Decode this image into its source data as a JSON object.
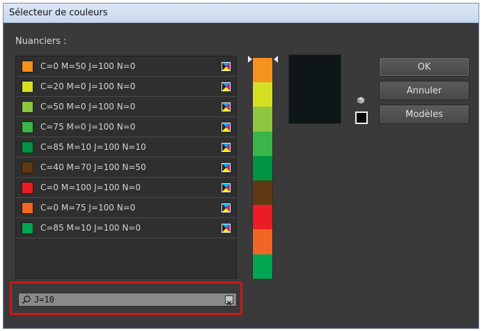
{
  "window": {
    "title": "Sélecteur de couleurs"
  },
  "nuanciers": {
    "label": "Nuanciers :"
  },
  "swatches": [
    {
      "name": "C=0 M=50 J=100 N=0",
      "color": "#f6921e"
    },
    {
      "name": "C=20 M=0 J=100 N=0",
      "color": "#d7df23"
    },
    {
      "name": "C=50 M=0 J=100 N=0",
      "color": "#8dc63f"
    },
    {
      "name": "C=75 M=0 J=100 N=0",
      "color": "#39b54a"
    },
    {
      "name": "C=85 M=10 J=100 N=10",
      "color": "#009444"
    },
    {
      "name": "C=40 M=70 J=100 N=50",
      "color": "#603913"
    },
    {
      "name": "C=0 M=100 J=100 N=0",
      "color": "#ed1c24"
    },
    {
      "name": "C=0 M=75 J=100 N=0",
      "color": "#f26522"
    },
    {
      "name": "C=85 M=10 J=100 N=0",
      "color": "#00a651"
    }
  ],
  "strip_colors": [
    "#f6921e",
    "#d7df23",
    "#8dc63f",
    "#39b54a",
    "#009444",
    "#603913",
    "#ed1c24",
    "#f26522",
    "#00a651"
  ],
  "preview": {
    "color": "#0f1618"
  },
  "buttons": {
    "ok": "OK",
    "cancel": "Annuler",
    "models": "Modèles"
  },
  "search": {
    "value": "J=10"
  }
}
